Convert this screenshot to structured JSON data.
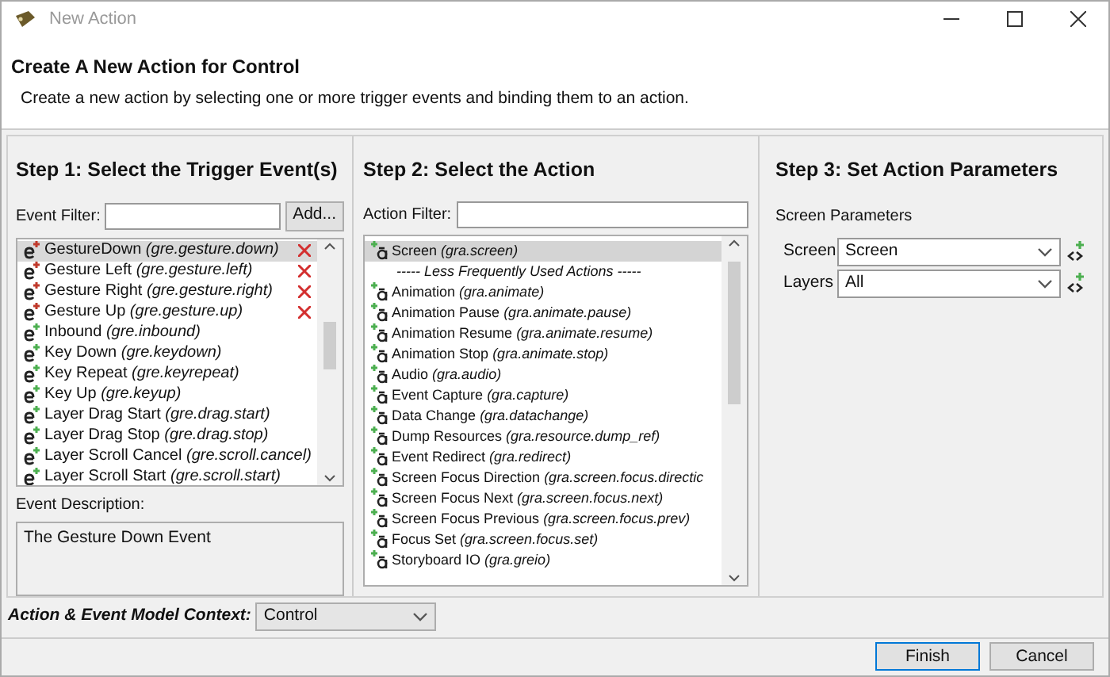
{
  "window": {
    "title": "New Action"
  },
  "header": {
    "title": "Create A New Action for Control",
    "description": "Create a new action by selecting one or more trigger events and binding them to an action."
  },
  "step1": {
    "title": "Step 1: Select the Trigger Event(s)",
    "filter_label": "Event Filter:",
    "add_button": "Add...",
    "events": [
      {
        "name": "GestureDown",
        "code": "(gre.gesture.down)",
        "bound": true,
        "selected": true
      },
      {
        "name": "Gesture Left",
        "code": "(gre.gesture.left)",
        "bound": true,
        "selected": false
      },
      {
        "name": "Gesture Right",
        "code": "(gre.gesture.right)",
        "bound": true,
        "selected": false
      },
      {
        "name": "Gesture Up",
        "code": "(gre.gesture.up)",
        "bound": true,
        "selected": false
      },
      {
        "name": "Inbound",
        "code": "(gre.inbound)",
        "bound": false,
        "selected": false
      },
      {
        "name": "Key Down",
        "code": "(gre.keydown)",
        "bound": false,
        "selected": false
      },
      {
        "name": "Key Repeat",
        "code": "(gre.keyrepeat)",
        "bound": false,
        "selected": false
      },
      {
        "name": "Key Up",
        "code": "(gre.keyup)",
        "bound": false,
        "selected": false
      },
      {
        "name": "Layer Drag Start",
        "code": "(gre.drag.start)",
        "bound": false,
        "selected": false
      },
      {
        "name": "Layer Drag Stop",
        "code": "(gre.drag.stop)",
        "bound": false,
        "selected": false
      },
      {
        "name": "Layer Scroll Cancel",
        "code": "(gre.scroll.cancel)",
        "bound": false,
        "selected": false
      },
      {
        "name": "Layer Scroll Start",
        "code": "(gre.scroll.start)",
        "bound": false,
        "selected": false
      }
    ],
    "description_label": "Event Description:",
    "description": "The Gesture Down Event"
  },
  "step2": {
    "title": "Step 2: Select the Action",
    "filter_label": "Action Filter:",
    "actions": [
      {
        "kind": "action",
        "name": "Screen",
        "code": "(gra.screen)",
        "selected": true
      },
      {
        "kind": "separator",
        "name": "----- Less Frequently Used Actions -----"
      },
      {
        "kind": "action",
        "name": "Animation",
        "code": "(gra.animate)",
        "selected": false
      },
      {
        "kind": "action",
        "name": "Animation Pause",
        "code": "(gra.animate.pause)",
        "selected": false
      },
      {
        "kind": "action",
        "name": "Animation Resume",
        "code": "(gra.animate.resume)",
        "selected": false
      },
      {
        "kind": "action",
        "name": "Animation Stop",
        "code": "(gra.animate.stop)",
        "selected": false
      },
      {
        "kind": "action",
        "name": "Audio",
        "code": "(gra.audio)",
        "selected": false
      },
      {
        "kind": "action",
        "name": "Event Capture",
        "code": "(gra.capture)",
        "selected": false
      },
      {
        "kind": "action",
        "name": "Data Change",
        "code": "(gra.datachange)",
        "selected": false
      },
      {
        "kind": "action",
        "name": "Dump Resources",
        "code": "(gra.resource.dump_ref)",
        "selected": false
      },
      {
        "kind": "action",
        "name": "Event Redirect",
        "code": "(gra.redirect)",
        "selected": false
      },
      {
        "kind": "action",
        "name": "Screen Focus Direction",
        "code": "(gra.screen.focus.directic",
        "selected": false
      },
      {
        "kind": "action",
        "name": "Screen Focus Next",
        "code": "(gra.screen.focus.next)",
        "selected": false
      },
      {
        "kind": "action",
        "name": "Screen Focus Previous",
        "code": "(gra.screen.focus.prev)",
        "selected": false
      },
      {
        "kind": "action",
        "name": "Focus Set",
        "code": "(gra.screen.focus.set)",
        "selected": false
      },
      {
        "kind": "action",
        "name": "Storyboard IO",
        "code": "(gra.greio)",
        "selected": false
      }
    ]
  },
  "step3": {
    "title": "Step 3: Set Action Parameters",
    "group_label": "Screen Parameters",
    "params": [
      {
        "label": "Screen",
        "value": "Screen"
      },
      {
        "label": "Layers",
        "value": "All"
      }
    ]
  },
  "context": {
    "label": "Action & Event Model Context:",
    "value": "Control"
  },
  "buttons": [
    {
      "label": "Finish",
      "kind": "default"
    },
    {
      "label": "Cancel",
      "kind": "normal"
    }
  ]
}
